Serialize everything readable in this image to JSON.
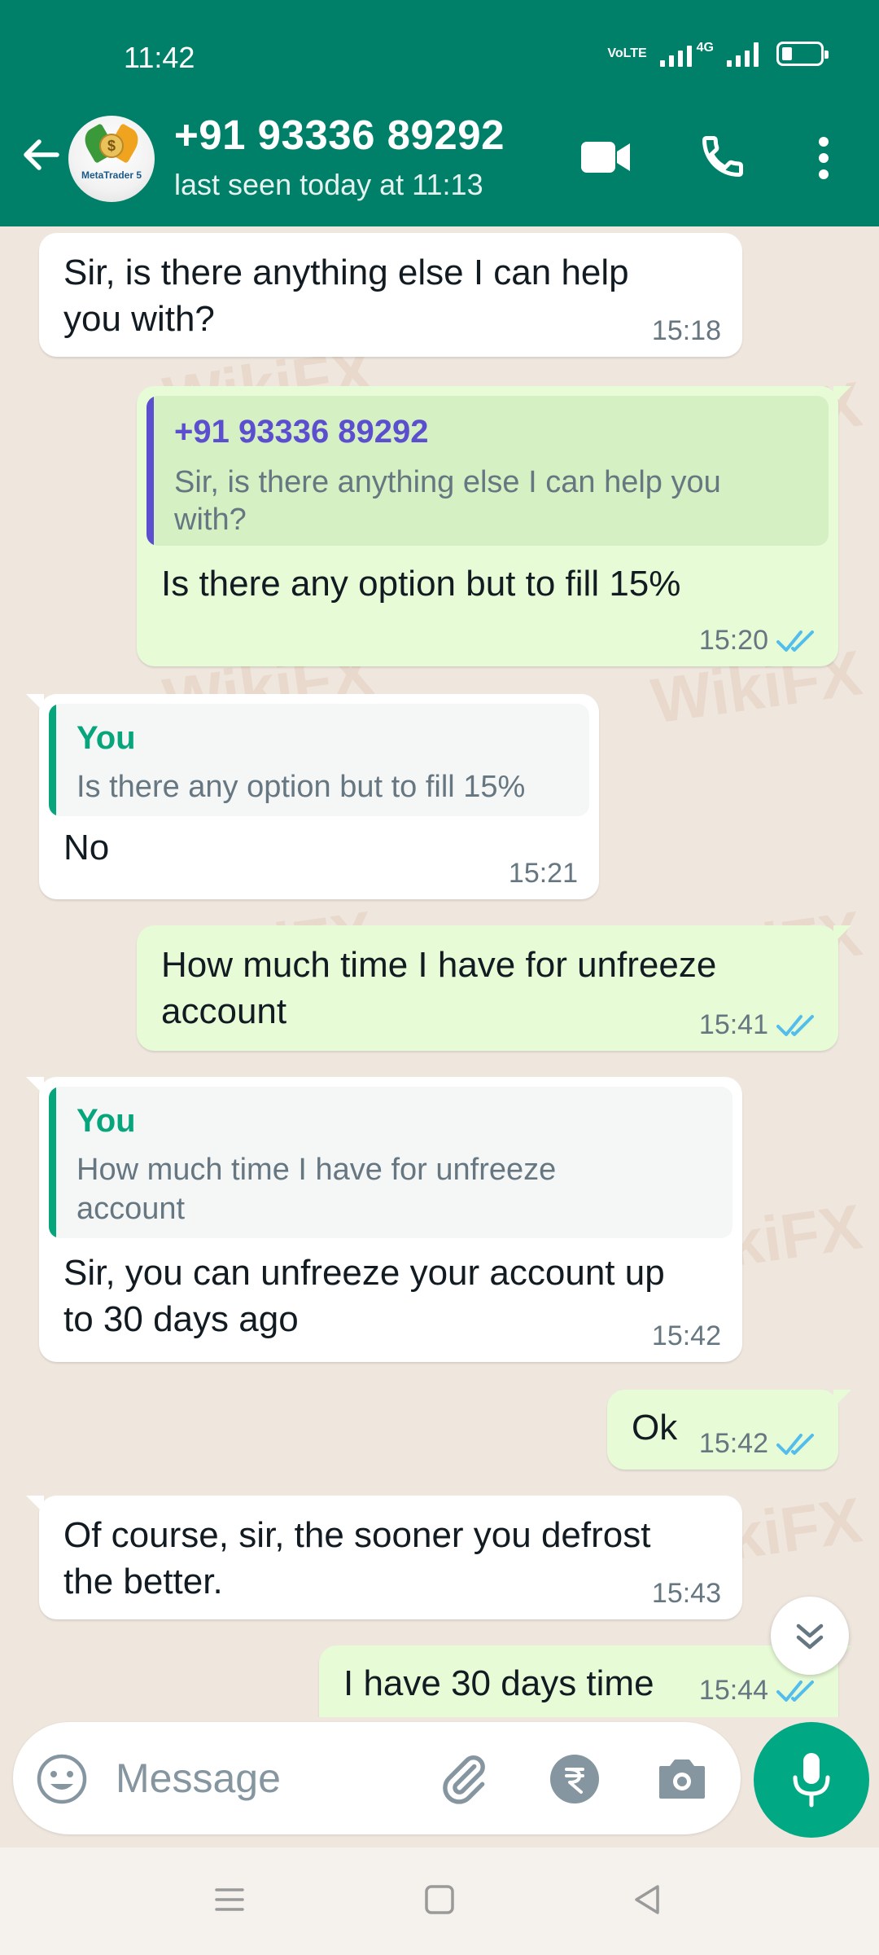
{
  "status_bar": {
    "time": "11:42",
    "network_label_1": "VoLTE",
    "network_label_2": "4G"
  },
  "header": {
    "contact_name": "+91 93336 89292",
    "last_seen": "last seen today at 11:13",
    "avatar_brand": "MetaTrader 5",
    "avatar_coin": "$",
    "icons": [
      "back-arrow-icon",
      "video-call-icon",
      "phone-icon",
      "more-vert-icon"
    ]
  },
  "watermark": "WikiFX",
  "messages": [
    {
      "dir": "in",
      "text_line1": "Sir, is there anything else I can help",
      "text_line2": "you with?",
      "time": "15:18"
    },
    {
      "dir": "out",
      "quote_name": "+91 93336 89292",
      "quote_line1": "Sir, is there anything else I can help you",
      "quote_line2": "with?",
      "text": "Is there any option but to fill 15%",
      "time": "15:20",
      "status": "read"
    },
    {
      "dir": "in",
      "quote_name": "You",
      "quote_line1": "Is there any option but to fill 15%",
      "text": "No",
      "time": "15:21"
    },
    {
      "dir": "out",
      "text_line1": "How much time I have for unfreeze",
      "text_line2": "account",
      "time": "15:41",
      "status": "read"
    },
    {
      "dir": "in",
      "quote_name": "You",
      "quote_line1": "How much time I have for unfreeze",
      "quote_line2": "account",
      "text_line1": "Sir, you can unfreeze your account up",
      "text_line2": "to 30 days ago",
      "time": "15:42"
    },
    {
      "dir": "out",
      "text": "Ok",
      "time": "15:42",
      "status": "read"
    },
    {
      "dir": "in",
      "text_line1": "Of course, sir, the sooner you defrost",
      "text_line2": "the better.",
      "time": "15:43"
    },
    {
      "dir": "out",
      "text": "I have 30 days time",
      "time": "15:44",
      "status": "read"
    }
  ],
  "input": {
    "placeholder": "Message",
    "icons": [
      "emoji-icon",
      "attach-icon",
      "rupee-payment-icon",
      "camera-icon",
      "mic-icon"
    ]
  },
  "colors": {
    "header": "#008069",
    "chat_bg": "#efe7de",
    "outgoing_bubble": "#e7fbd7",
    "incoming_bubble": "#ffffff",
    "quote_author_you": "#06a57c",
    "quote_author_contact": "#5b4fd0",
    "read_ticks": "#53bdeb",
    "mic_button": "#00a884"
  }
}
